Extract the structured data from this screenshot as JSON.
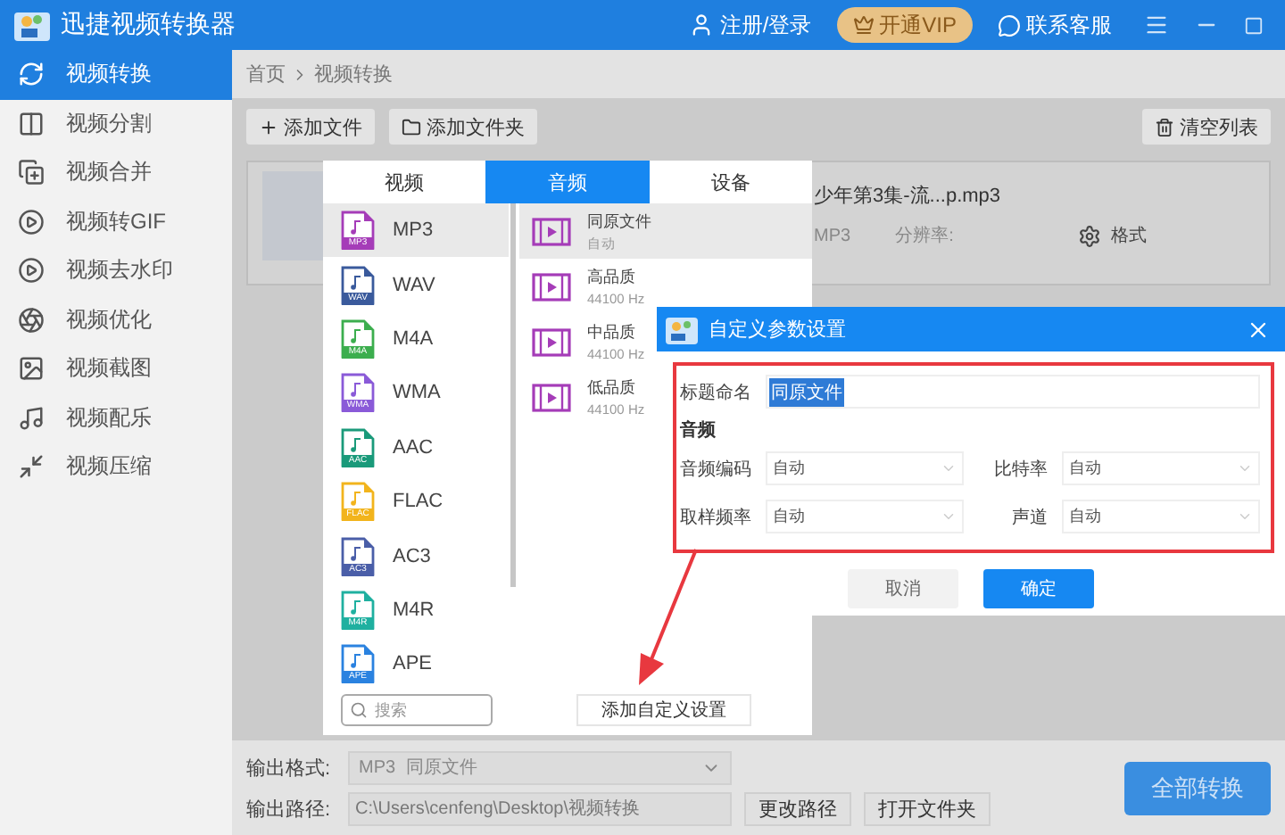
{
  "app": {
    "title": "迅捷视频转换器",
    "login": "注册/登录",
    "vip": "开通VIP",
    "support": "联系客服"
  },
  "sidebar": {
    "items": [
      {
        "label": "视频转换",
        "selected": true
      },
      {
        "label": "视频分割",
        "selected": false
      },
      {
        "label": "视频合并",
        "selected": false
      },
      {
        "label": "视频转GIF",
        "selected": false
      },
      {
        "label": "视频去水印",
        "selected": false
      },
      {
        "label": "视频优化",
        "selected": false
      },
      {
        "label": "视频截图",
        "selected": false
      },
      {
        "label": "视频配乐",
        "selected": false
      },
      {
        "label": "视频压缩",
        "selected": false
      }
    ]
  },
  "breadcrumb": {
    "home": "首页",
    "current": "视频转换"
  },
  "toolbar": {
    "add_file": "添加文件",
    "add_folder": "添加文件夹",
    "clear": "清空列表"
  },
  "file": {
    "name": "少年第3集-流...p.mp3",
    "format": "MP3",
    "resolution_label": "分辨率:",
    "settings": "格式"
  },
  "format_popup": {
    "tabs": [
      {
        "label": "视频",
        "selected": false
      },
      {
        "label": "音频",
        "selected": true
      },
      {
        "label": "设备",
        "selected": false
      }
    ],
    "formats": [
      {
        "label": "MP3",
        "badge": "MP3",
        "color": "#a53cb8",
        "selected": true
      },
      {
        "label": "WAV",
        "badge": "WAV",
        "color": "#3a5a9c",
        "selected": false
      },
      {
        "label": "M4A",
        "badge": "M4A",
        "color": "#3cae4e",
        "selected": false
      },
      {
        "label": "WMA",
        "badge": "WMA",
        "color": "#8a5ad8",
        "selected": false
      },
      {
        "label": "AAC",
        "badge": "AAC",
        "color": "#1a9a7a",
        "selected": false
      },
      {
        "label": "FLAC",
        "badge": "FLAC",
        "color": "#f2b41c",
        "selected": false
      },
      {
        "label": "AC3",
        "badge": "AC3",
        "color": "#4a5ea8",
        "selected": false
      },
      {
        "label": "M4R",
        "badge": "M4R",
        "color": "#1fb0a0",
        "selected": false
      },
      {
        "label": "APE",
        "badge": "APE",
        "color": "#2a82e0",
        "selected": false
      }
    ],
    "presets": [
      {
        "name": "同原文件",
        "detail": "自动",
        "selected": true
      },
      {
        "name": "高品质",
        "detail": "44100 Hz",
        "selected": false
      },
      {
        "name": "中品质",
        "detail": "44100 Hz",
        "selected": false
      },
      {
        "name": "低品质",
        "detail": "44100 Hz",
        "selected": false
      }
    ],
    "search_placeholder": "搜索",
    "add_custom": "添加自定义设置"
  },
  "dialog": {
    "title": "自定义参数设置",
    "name_label": "标题命名",
    "name_value": "同原文件",
    "section": "音频",
    "fields": [
      {
        "label": "音频编码",
        "value": "自动"
      },
      {
        "label": "比特率",
        "value": "自动"
      },
      {
        "label": "取样频率",
        "value": "自动"
      },
      {
        "label": "声道",
        "value": "自动"
      }
    ],
    "cancel": "取消",
    "ok": "确定"
  },
  "output": {
    "format_label": "输出格式:",
    "format": "MP3",
    "preset": "同原文件",
    "path_label": "输出路径:",
    "path": "C:\\Users\\cenfeng\\Desktop\\视频转换",
    "change_path": "更改路径",
    "open_folder": "打开文件夹",
    "convert_all": "全部转换"
  }
}
